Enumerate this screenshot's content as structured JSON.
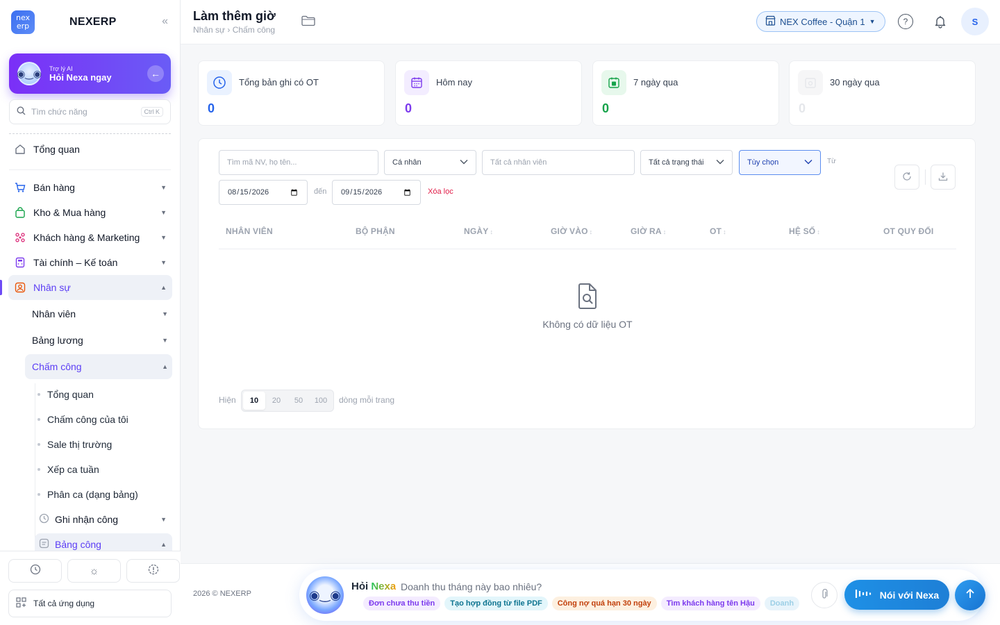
{
  "brand": {
    "logo_line1": "nex",
    "logo_line2": "erp",
    "name": "NEXERP"
  },
  "ai_card": {
    "subtitle": "Trợ lý AI",
    "title": "Hỏi Nexa ngay"
  },
  "search": {
    "placeholder": "Tìm chức năng",
    "shortcut": "Ctrl K"
  },
  "sidebar": {
    "overview": "Tổng quan",
    "modules": [
      {
        "label": "Bán hàng"
      },
      {
        "label": "Kho & Mua hàng"
      },
      {
        "label": "Khách hàng & Marketing"
      },
      {
        "label": "Tài chính – Kế toán"
      },
      {
        "label": "Nhân sự"
      }
    ],
    "hr_sub": [
      {
        "label": "Nhân viên"
      },
      {
        "label": "Bảng lương"
      },
      {
        "label": "Chấm công"
      }
    ],
    "attendance_items": [
      {
        "label": "Tổng quan"
      },
      {
        "label": "Chấm công của tôi"
      },
      {
        "label": "Sale thị trường"
      },
      {
        "label": "Xếp ca tuần"
      },
      {
        "label": "Phân ca (dạng bảng)"
      }
    ],
    "attendance_groups": [
      {
        "label": "Ghi nhận công"
      },
      {
        "label": "Bảng công"
      }
    ],
    "all_apps": "Tất cả ứng dụng"
  },
  "header": {
    "title": "Làm thêm giờ",
    "breadcrumb": "Nhân sự › Chấm công",
    "store": "NEX Coffee - Quận 1",
    "help": "?",
    "avatar": "S"
  },
  "stats": [
    {
      "label": "Tổng bản ghi có OT",
      "value": "0",
      "color": "#2563eb",
      "icon": "clock-icon"
    },
    {
      "label": "Hôm nay",
      "value": "0",
      "color": "#7c3aed",
      "icon": "calendar-icon"
    },
    {
      "label": "7 ngày qua",
      "value": "0",
      "color": "#16a34a",
      "icon": "calendar-week-icon"
    },
    {
      "label": "30 ngày qua",
      "value": "0",
      "color": "#e5e7eb",
      "icon": "calendar-month-icon"
    }
  ],
  "filters": {
    "search_placeholder": "Tìm mã NV, họ tên...",
    "scope": "Cá nhân",
    "employee_placeholder": "Tất cả nhân viên",
    "status": "Tất cả trạng thái",
    "range": "Tùy chọn",
    "from_label": "Từ",
    "date_from": "2026-08-15",
    "to_label": "đến",
    "date_to": "2026-09-15",
    "clear": "Xóa lọc"
  },
  "table": {
    "columns": [
      {
        "label": "NHÂN VIÊN",
        "sortable": false
      },
      {
        "label": "BỘ PHẬN",
        "sortable": false
      },
      {
        "label": "NGÀY",
        "sortable": true
      },
      {
        "label": "GIỜ VÀO",
        "sortable": true
      },
      {
        "label": "GIỜ RA",
        "sortable": true
      },
      {
        "label": "OT",
        "sortable": true
      },
      {
        "label": "HỆ SỐ",
        "sortable": true
      },
      {
        "label": "OT QUY ĐỔI",
        "sortable": false
      }
    ],
    "empty_text": "Không có dữ liệu OT"
  },
  "pagination": {
    "show_label": "Hiện",
    "sizes": [
      "10",
      "20",
      "50",
      "100"
    ],
    "selected": "10",
    "suffix": "dòng mỗi trang"
  },
  "footer": {
    "copyright": "2026 © NEXERP",
    "ask_prefix": "Hỏi",
    "ask_name": "Nexa",
    "prompt": "Doanh thu tháng này bao nhiêu?",
    "chips": [
      "Đơn chưa thu tiền",
      "Tạo hợp đồng từ file PDF",
      "Công nợ quá hạn 30 ngày",
      "Tìm khách hàng tên Hậu",
      "Doanh"
    ],
    "voice_label": "Nói với Nexa"
  }
}
